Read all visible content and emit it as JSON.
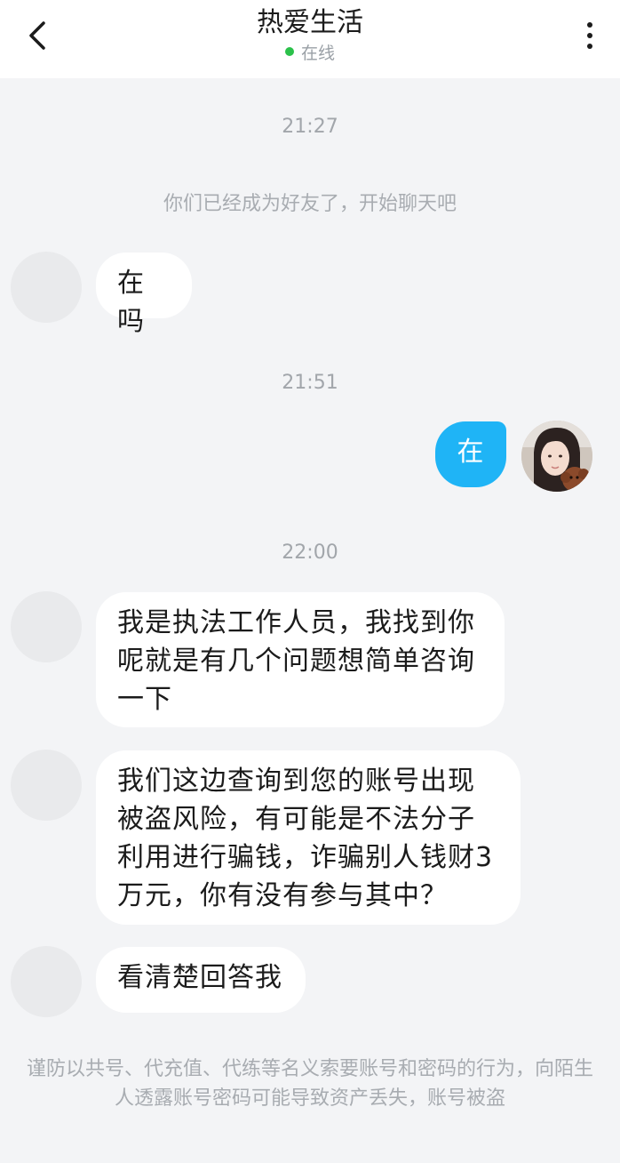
{
  "header": {
    "title": "热爱生活",
    "status": "在线",
    "status_color": "#2bc14a"
  },
  "chat": {
    "messages": [
      {
        "type": "time",
        "text": "21:27"
      },
      {
        "type": "system",
        "text": "你们已经成为好友了，开始聊天吧"
      },
      {
        "type": "incoming",
        "text": "在吗"
      },
      {
        "type": "time",
        "text": "21:51"
      },
      {
        "type": "outgoing",
        "text": "在"
      },
      {
        "type": "time",
        "text": "22:00"
      },
      {
        "type": "incoming",
        "text": "我是执法工作人员，我找到你呢就是有几个问题想简单咨询一下"
      },
      {
        "type": "incoming",
        "text": "我们这边查询到您的账号出现被盗风险，有可能是不法分子利用进行骗钱，诈骗别人钱财3万元，你有没有参与其中？"
      },
      {
        "type": "incoming",
        "text": "看清楚回答我"
      }
    ]
  },
  "footer": {
    "warning": "谨防以共号、代充值、代练等名义索要账号和密码的行为，向陌生人透露账号密码可能导致资产丢失，账号被盗"
  },
  "colors": {
    "outgoing_bubble": "#1fb4f6",
    "incoming_bubble": "#ffffff",
    "background": "#f3f4f6"
  },
  "icons": [
    "back-arrow-icon",
    "more-vertical-icon"
  ]
}
